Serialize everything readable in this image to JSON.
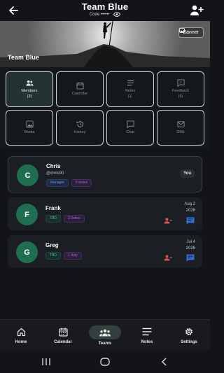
{
  "header": {
    "title": "Team Blue",
    "code_label": "Code",
    "code_value": "••••••",
    "back_icon": "arrow-left-icon",
    "add_member_icon": "person-add-icon"
  },
  "hero": {
    "team_name": "Team Blue",
    "banner_button": "Banner",
    "banner_icon": "image-icon"
  },
  "grid": {
    "tiles": [
      {
        "label": "Members",
        "count": "(3)",
        "icon": "people-icon"
      },
      {
        "label": "Calendar",
        "count": "",
        "icon": "calendar-icon"
      },
      {
        "label": "Notes",
        "count": "(1)",
        "icon": "notes-icon"
      },
      {
        "label": "Feedback",
        "count": "(6)",
        "icon": "feedback-icon"
      },
      {
        "label": "Media",
        "count": "",
        "icon": "photo-icon"
      },
      {
        "label": "History",
        "count": "",
        "icon": "history-icon"
      },
      {
        "label": "Chat",
        "count": "",
        "icon": "chat-icon"
      },
      {
        "label": "DMs",
        "count": "",
        "icon": "mail-icon"
      }
    ]
  },
  "members": [
    {
      "initial": "C",
      "name": "Chris",
      "handle": "@chris90",
      "tags": [
        "Manager",
        "0 duties"
      ],
      "badge": "You"
    },
    {
      "initial": "F",
      "name": "Frank",
      "tags": [
        "TBD",
        "2 duties"
      ],
      "date_line1": "Aug 2",
      "date_line2": "2026"
    },
    {
      "initial": "G",
      "name": "Greg",
      "tags": [
        "TBD",
        "1 duty"
      ],
      "date_line1": "Jul 4",
      "date_line2": "2026"
    }
  ],
  "bottom_nav": {
    "items": [
      {
        "label": "Home",
        "icon": "home-icon"
      },
      {
        "label": "Calendar",
        "icon": "calendar-icon"
      },
      {
        "label": "Teams",
        "icon": "groups-icon"
      },
      {
        "label": "Notes",
        "icon": "notes-icon"
      },
      {
        "label": "Settings",
        "icon": "gear-icon"
      }
    ],
    "active": "Teams"
  },
  "colors": {
    "background": "#121419",
    "accent_green": "#1f6e51",
    "active_tile": "#243231",
    "remove_red": "#d9534f",
    "chat_blue": "#2f6fd8"
  }
}
